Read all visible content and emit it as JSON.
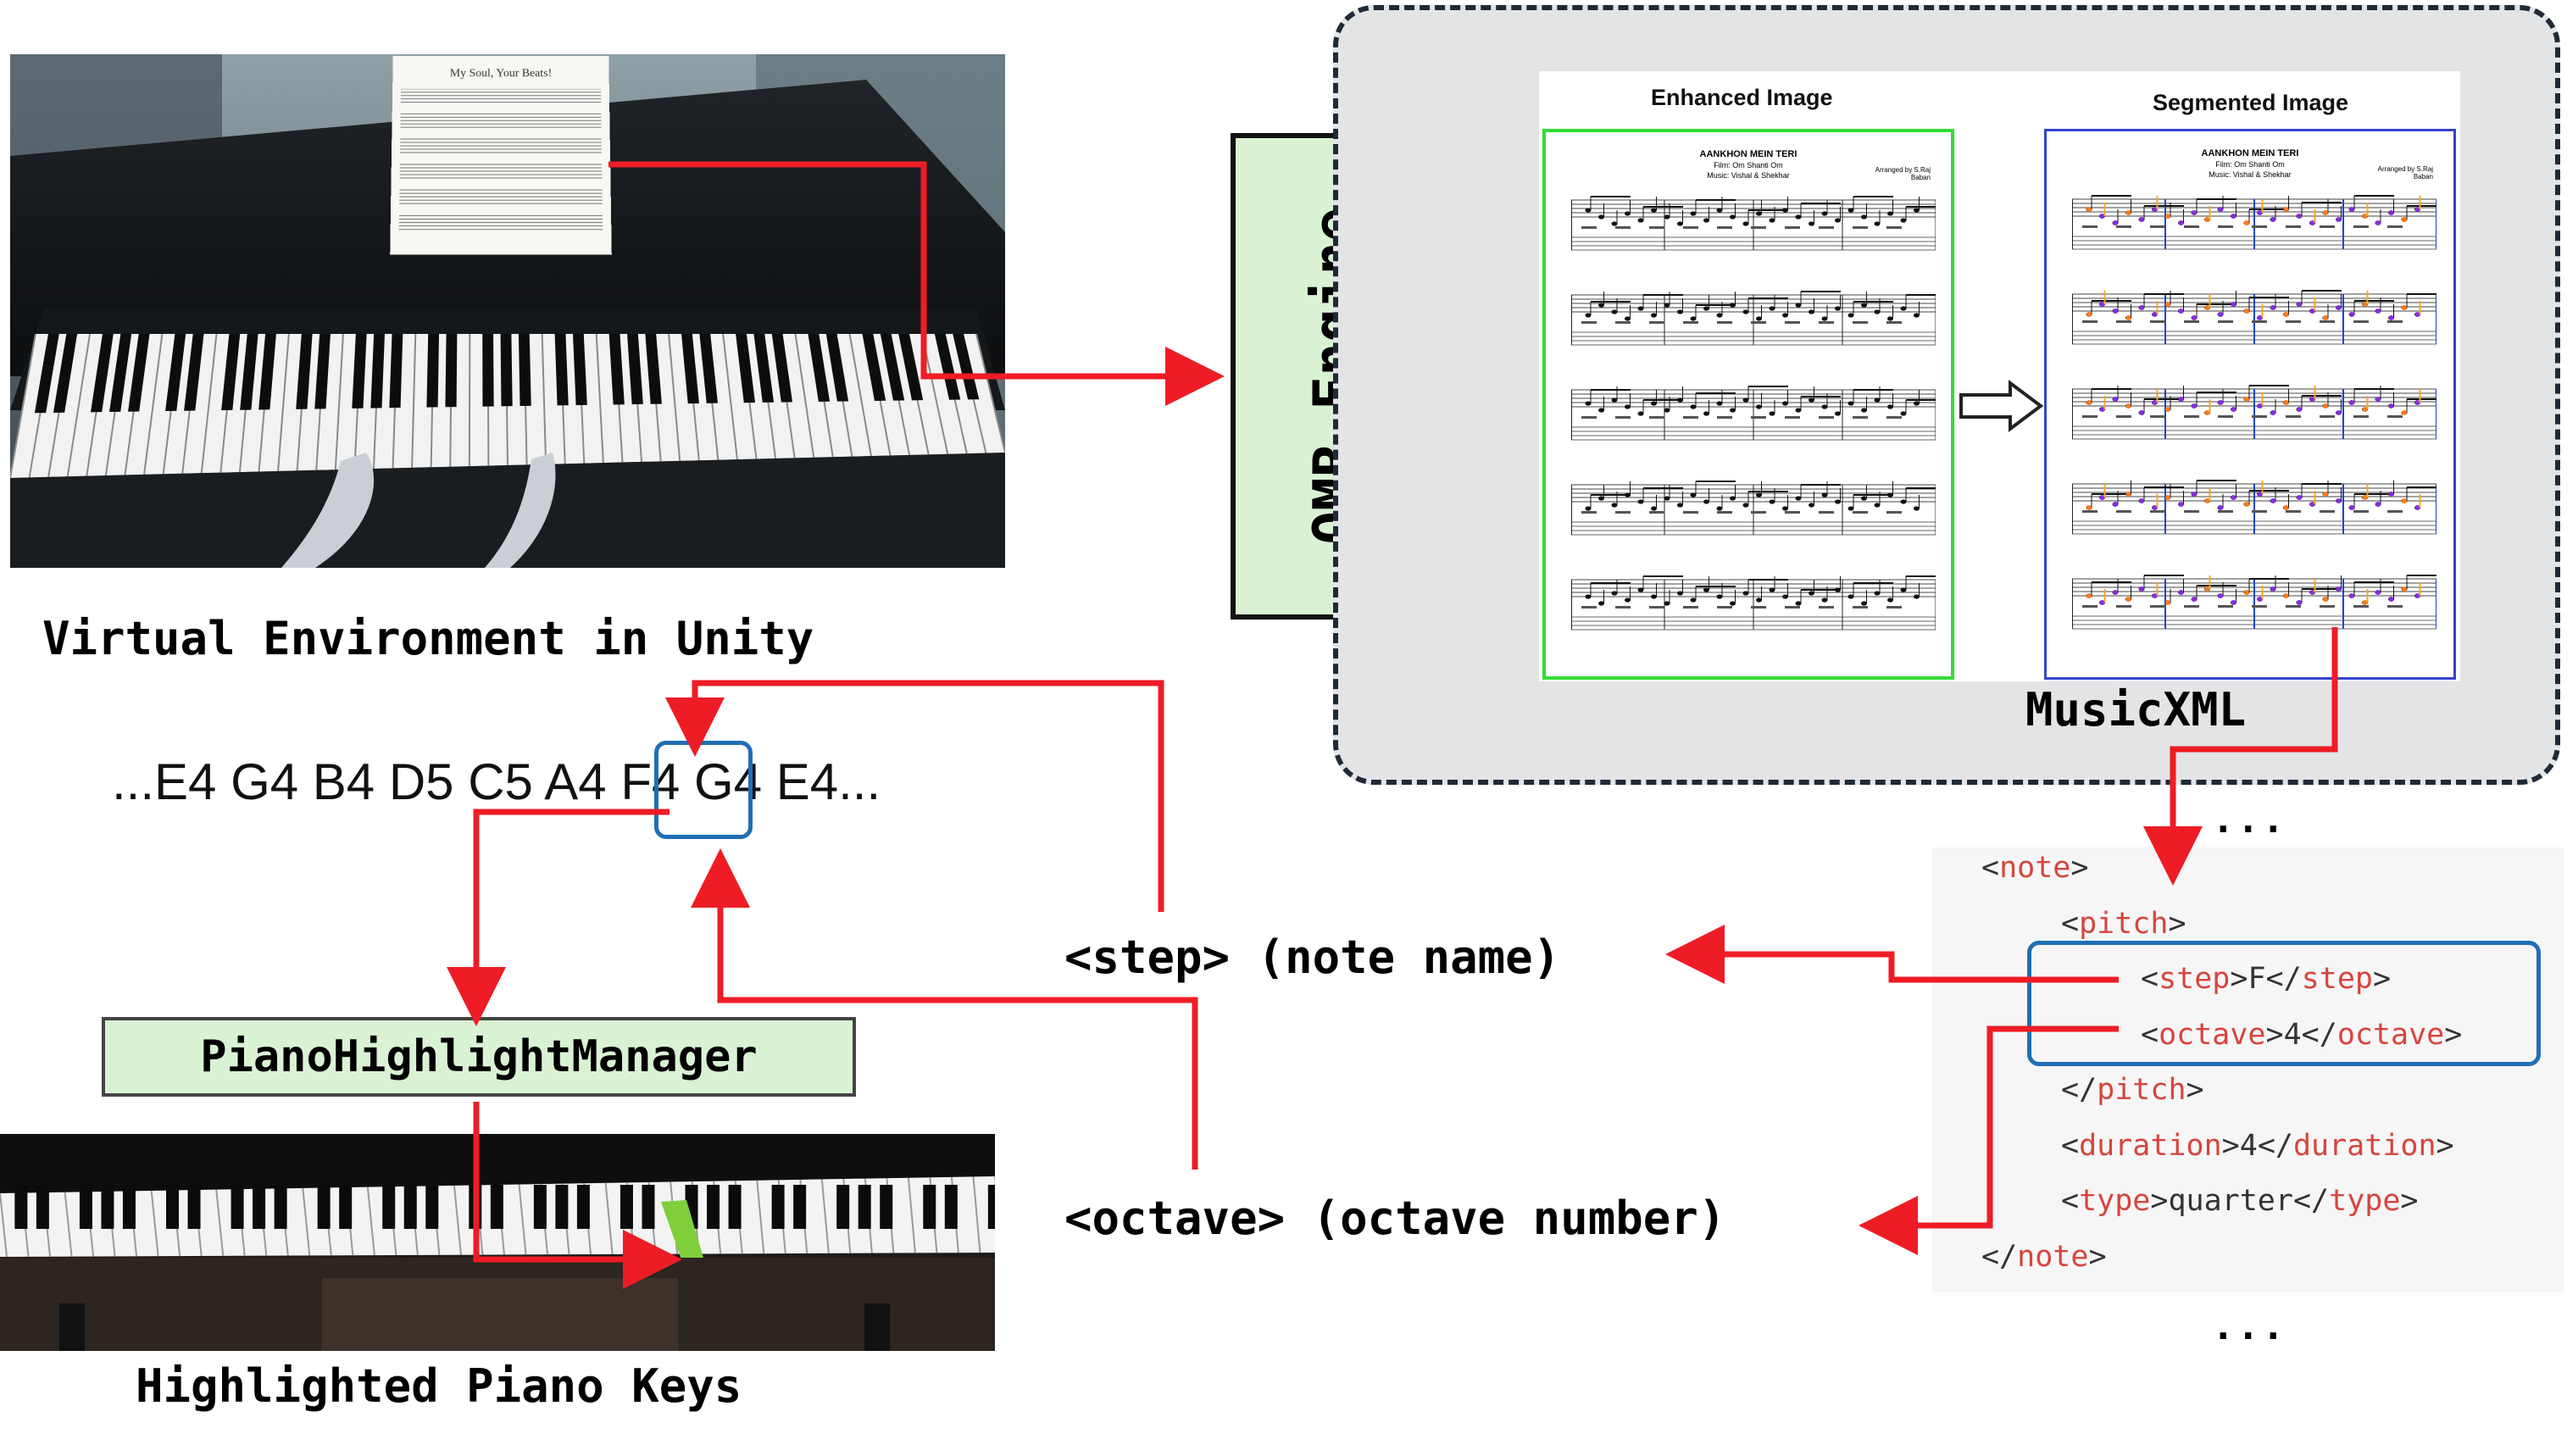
{
  "scene": {
    "caption": "Virtual Environment in Unity",
    "sheet_title": "My Soul, Your Beats!"
  },
  "omr": {
    "label": "OMR Engine"
  },
  "panel": {
    "enhanced_title": "Enhanced Image",
    "segmented_title": "Segmented Image",
    "musicxml_label": "MusicXML",
    "song_title": "AANKHON MEIN TERI",
    "song_film": "Film: Om Shanti Om",
    "song_music": "Music: Vishal & Shekhar",
    "song_arranged": "Arranged by S.Raj Baban"
  },
  "sequence": {
    "before": "...E4 G4 B4 D5 C5 A4 ",
    "highlight": "F4",
    "after": " G4 E4..."
  },
  "manager": {
    "label": "PianoHighlightManager"
  },
  "keys_caption": "Highlighted Piano Keys",
  "labels": {
    "step": "<step> (note name)",
    "octave": "<octave> (octave number)"
  },
  "xml": {
    "dots_top": "...",
    "dots_bottom": "...",
    "lines": [
      {
        "indent": 0,
        "pre": "<",
        "tag": "note",
        "mid": ">",
        "val": "",
        "close": ""
      },
      {
        "indent": 1,
        "pre": "<",
        "tag": "pitch",
        "mid": ">",
        "val": "",
        "close": ""
      },
      {
        "indent": 2,
        "pre": "<",
        "tag": "step",
        "mid": ">",
        "val": "F",
        "close": "step"
      },
      {
        "indent": 2,
        "pre": "<",
        "tag": "octave",
        "mid": ">",
        "val": "4",
        "close": "octave"
      },
      {
        "indent": 1,
        "pre": "</",
        "tag": "pitch",
        "mid": ">",
        "val": "",
        "close": ""
      },
      {
        "indent": 1,
        "pre": "<",
        "tag": "duration",
        "mid": ">",
        "val": "4",
        "close": "duration"
      },
      {
        "indent": 1,
        "pre": "<",
        "tag": "type",
        "mid": ">",
        "val": "quarter",
        "close": "type"
      },
      {
        "indent": 0,
        "pre": "</",
        "tag": "note",
        "mid": ">",
        "val": "",
        "close": ""
      }
    ]
  },
  "colors": {
    "arrow": "#ee1c25",
    "green_box": "#d9f2d4",
    "blue_box": "#1f6fb5",
    "enhanced_border": "#33dd33",
    "segmented_border": "#3344cc",
    "key_highlight": "#7fcf3a",
    "xml_tag": "#d6453d"
  },
  "icons": [
    "piano-icon",
    "hand-icon",
    "sheet-music-icon",
    "double-arrow-icon"
  ]
}
